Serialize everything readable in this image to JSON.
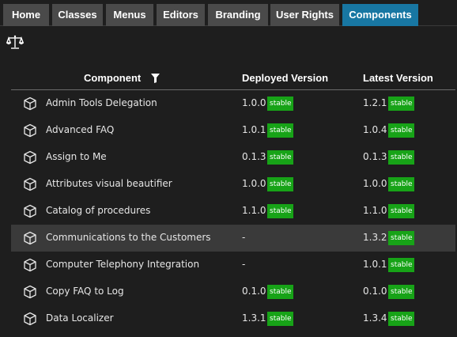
{
  "tabs": [
    {
      "label": "Home",
      "active": false
    },
    {
      "label": "Classes",
      "active": false
    },
    {
      "label": "Menus",
      "active": false
    },
    {
      "label": "Editors",
      "active": false
    },
    {
      "label": "Branding",
      "active": false
    },
    {
      "label": "User Rights",
      "active": false
    },
    {
      "label": "Components",
      "active": true
    }
  ],
  "colors": {
    "active_tab": "#1877a3",
    "inactive_tab": "#4a4a4a",
    "stable_badge": "#17a317",
    "highlight_row": "#3a3a3a"
  },
  "table": {
    "columns": {
      "component": "Component",
      "deployed": "Deployed Version",
      "latest": "Latest Version"
    },
    "rows": [
      {
        "name": "Admin Tools Delegation",
        "deployed": "1.0.0",
        "deployed_badge": "stable",
        "latest": "1.2.1",
        "latest_badge": "stable"
      },
      {
        "name": "Advanced FAQ",
        "deployed": "1.0.1",
        "deployed_badge": "stable",
        "latest": "1.0.4",
        "latest_badge": "stable"
      },
      {
        "name": "Assign to Me",
        "deployed": "0.1.3",
        "deployed_badge": "stable",
        "latest": "0.1.3",
        "latest_badge": "stable"
      },
      {
        "name": "Attributes visual beautifier",
        "deployed": "1.0.0",
        "deployed_badge": "stable",
        "latest": "1.0.0",
        "latest_badge": "stable"
      },
      {
        "name": "Catalog of procedures",
        "deployed": "1.1.0",
        "deployed_badge": "stable",
        "latest": "1.1.0",
        "latest_badge": "stable"
      },
      {
        "name": "Communications to the Customers",
        "deployed": "-",
        "deployed_badge": "",
        "latest": "1.3.2",
        "latest_badge": "stable"
      },
      {
        "name": "Computer Telephony Integration",
        "deployed": "-",
        "deployed_badge": "",
        "latest": "1.0.1",
        "latest_badge": "stable"
      },
      {
        "name": "Copy FAQ to Log",
        "deployed": "0.1.0",
        "deployed_badge": "stable",
        "latest": "0.1.0",
        "latest_badge": "stable"
      },
      {
        "name": "Data Localizer",
        "deployed": "1.3.1",
        "deployed_badge": "stable",
        "latest": "1.3.4",
        "latest_badge": "stable"
      }
    ]
  }
}
